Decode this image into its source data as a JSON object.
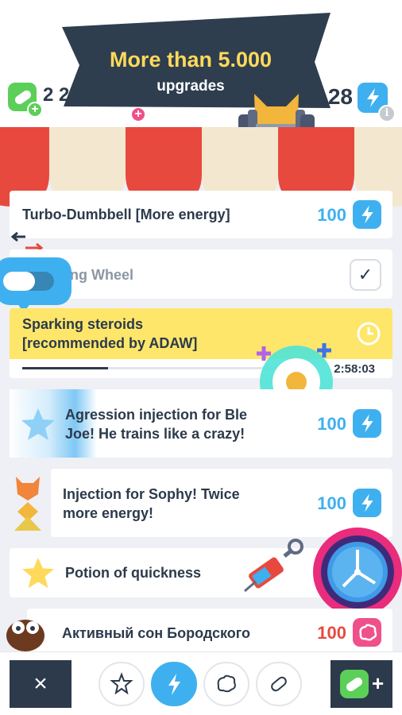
{
  "promo": {
    "title": "More than 5.000",
    "subtitle": "upgrades"
  },
  "stats": {
    "pills": "2 20",
    "energy": "28"
  },
  "items": [
    {
      "label": "Turbo-Dumbbell [More energy]",
      "price": "100",
      "currency": "bolt-icon"
    },
    {
      "label": "ng Wheel",
      "state": "purchased",
      "icon": "checkmark-icon"
    },
    {
      "label_line1": "Sparking steroids",
      "label_line2": "[recommended by ADAW]",
      "timer": "2:58:03",
      "progress": 0.3,
      "icon": "clock-icon"
    },
    {
      "label_line1": "Agression injection for Bl",
      "label_line1_tail": "e",
      "label_line2": "Joe! He trains like a crazy!",
      "price": "100",
      "currency": "bolt-icon"
    },
    {
      "label_line1": "Injection for Sophy! Twice",
      "label_line2": "more energy!",
      "price": "100",
      "currency": "bolt-icon"
    },
    {
      "label": "Potion of quickness",
      "icon": "star-icon"
    },
    {
      "label": "Активный сон Бородского",
      "price": "100",
      "currency": "brain-icon"
    }
  ],
  "bottom_tabs": [
    {
      "name": "star-icon",
      "active": false
    },
    {
      "name": "bolt-icon",
      "active": true
    },
    {
      "name": "brain-icon",
      "active": false
    },
    {
      "name": "pill-icon",
      "active": false
    }
  ],
  "colors": {
    "accent_blue": "#3fb0ef",
    "pill_green": "#5bcf58",
    "brain_pink": "#f0508a",
    "dark_navy": "#2c3a4b",
    "promo_yellow": "#ffd95a",
    "highlight_yellow": "#fde66a"
  },
  "icons": {
    "close": "×",
    "plus": "+",
    "info": "i",
    "check": "✓"
  }
}
